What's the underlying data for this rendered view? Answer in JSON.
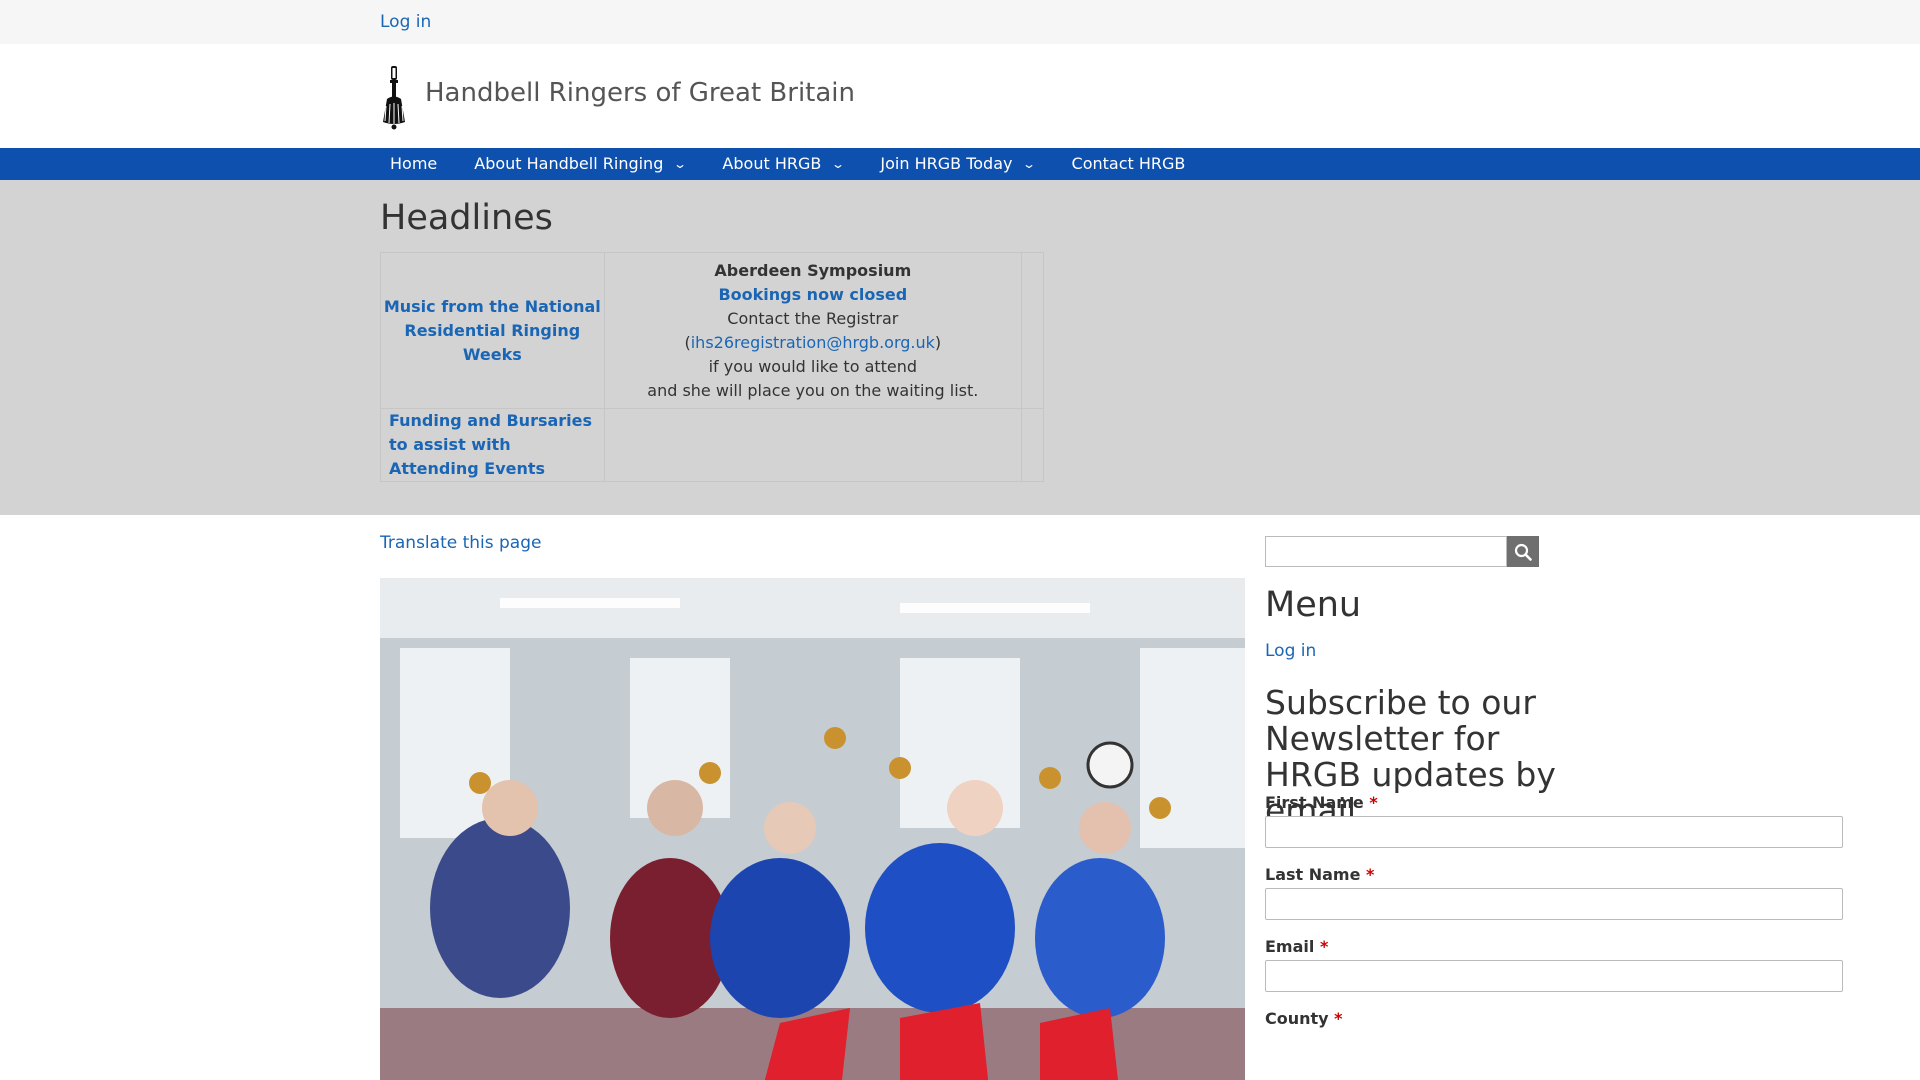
{
  "topbar": {
    "login_label": "Log in"
  },
  "branding": {
    "site_name": "Handbell Ringers of Great Britain",
    "logo_icon": "handbell-icon"
  },
  "nav": {
    "items": [
      {
        "label": "Home",
        "has_dropdown": false
      },
      {
        "label": "About Handbell Ringing",
        "has_dropdown": true
      },
      {
        "label": "About HRGB",
        "has_dropdown": true
      },
      {
        "label": "Join HRGB Today",
        "has_dropdown": true
      },
      {
        "label": "Contact HRGB",
        "has_dropdown": false
      }
    ],
    "chevron": "⌄"
  },
  "headlines": {
    "title": "Headlines",
    "link_music": "Music from the National Residential Ringing Weeks",
    "symposium_title": "Aberdeen Symposium",
    "bookings_link": "Bookings now closed",
    "contact_prefix": "Contact the Registrar (",
    "contact_email": "ihs26registration@hrgb.org.uk",
    "contact_suffix": ")",
    "line_attend": "if you would like to attend",
    "line_waiting": "and she will place you on the waiting list.",
    "link_funding": "Funding and Bursaries to assist with Attending Events"
  },
  "main": {
    "translate_label": "Translate this page"
  },
  "sidebar": {
    "search_placeholder": "",
    "search_icon": "search-icon",
    "menu_title": "Menu",
    "menu_login": "Log in",
    "subscribe_title": "Subscribe to our Newsletter for HRGB updates by email",
    "fields": [
      {
        "label": "First Name",
        "required_mark": "*"
      },
      {
        "label": "Last Name",
        "required_mark": "*"
      },
      {
        "label": "Email",
        "required_mark": "*"
      },
      {
        "label": "County",
        "required_mark": "*"
      }
    ]
  },
  "colors": {
    "nav_bg": "#0e50ad",
    "link": "#1a66b5",
    "headlines_bg": "#d3d3d3",
    "required": "#cc0000"
  }
}
